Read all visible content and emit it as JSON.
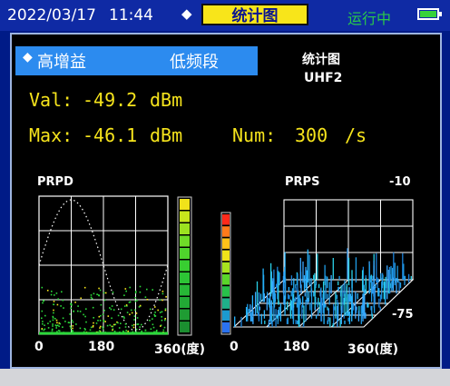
{
  "status": {
    "date": "2022/03/17",
    "time": "11:44",
    "mode_title": "统计图",
    "run_state": "运行中"
  },
  "selector": {
    "gain": "高增益",
    "band": "低频段"
  },
  "info": {
    "chart_title": "统计图",
    "sensor": "UHF2"
  },
  "readings": {
    "val_label": "Val:",
    "val_value": "-49.2",
    "val_unit": "dBm",
    "max_label": "Max:",
    "max_value": "-46.1",
    "max_unit": "dBm",
    "num_label": "Num:",
    "num_value": "300",
    "num_unit": "/s"
  },
  "prpd": {
    "label": "PRPD",
    "x_ticks": [
      "0",
      "180",
      "360(度)"
    ]
  },
  "prps": {
    "label": "PRPS",
    "top_value": "-10",
    "bottom_value": "-75",
    "x_ticks": [
      "0",
      "180",
      "360(度)"
    ]
  },
  "colors": {
    "status_bar": "#0f2aa4",
    "screen_bg": "#000000",
    "mode_tab": "#f8e51a",
    "selector": "#2c8bef",
    "reading_text": "#f6e41c",
    "running": "#29c94a",
    "points_low": "#2bd93a",
    "points_high": "#f6e41c"
  },
  "icons": {
    "status_marker": "diamond-icon",
    "selector_marker": "diamond-icon",
    "battery": "battery-icon"
  }
}
